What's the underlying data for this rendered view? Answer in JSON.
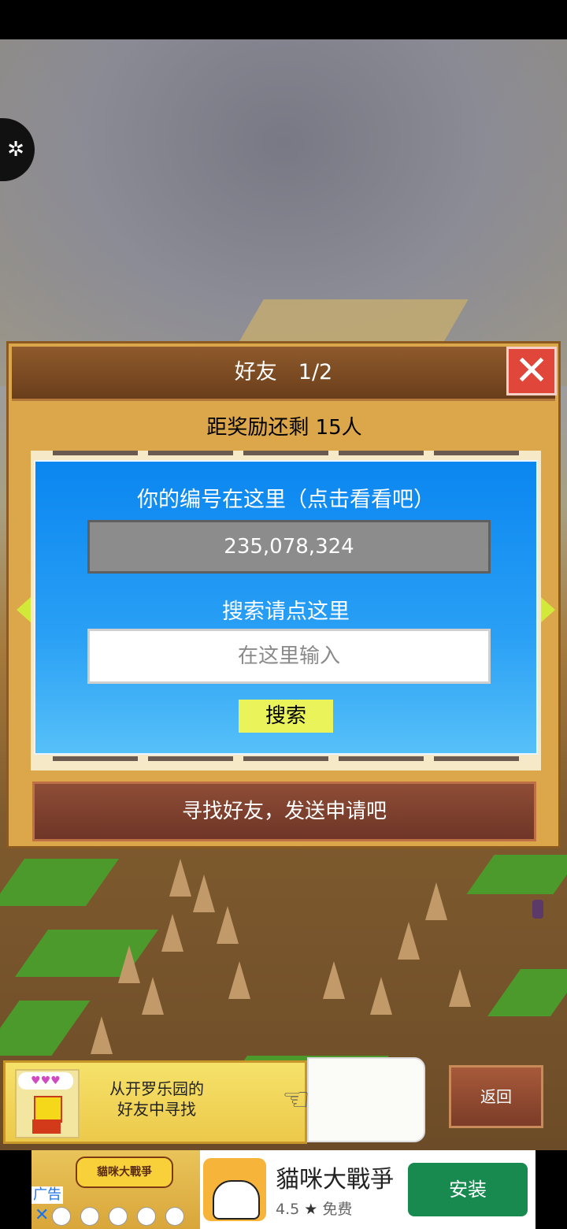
{
  "dialog": {
    "title": "好友　1/2",
    "close_icon": "close-x-icon",
    "reward_text": "距奖励还剩 15人",
    "panel": {
      "id_label": "你的编号在这里（点击看看吧）",
      "id_value": "235,078,324",
      "search_label": "搜索请点这里",
      "search_placeholder": "在这里输入",
      "search_button": "搜索"
    },
    "prev_page_icon": "triangle-left-icon",
    "next_page_icon": "triangle-right-icon",
    "send_request_button": "寻找好友，发送申请吧"
  },
  "tip": {
    "line1": "从开罗乐园的",
    "line2": "好友中寻找",
    "hearts": "♥♥♥"
  },
  "back_button": "返回",
  "ad": {
    "label": "广告",
    "close": "✕",
    "banner_title": "貓咪大戰爭",
    "app_name": "貓咪大戰爭",
    "rating": "4.5",
    "price": "免费",
    "install_button": "安装"
  },
  "colors": {
    "panel_blue": "#0a86f0",
    "dialog_tan": "#dba74a",
    "close_red": "#e0463a",
    "search_button_yellow": "#eaf35a",
    "install_green": "#188a50"
  }
}
